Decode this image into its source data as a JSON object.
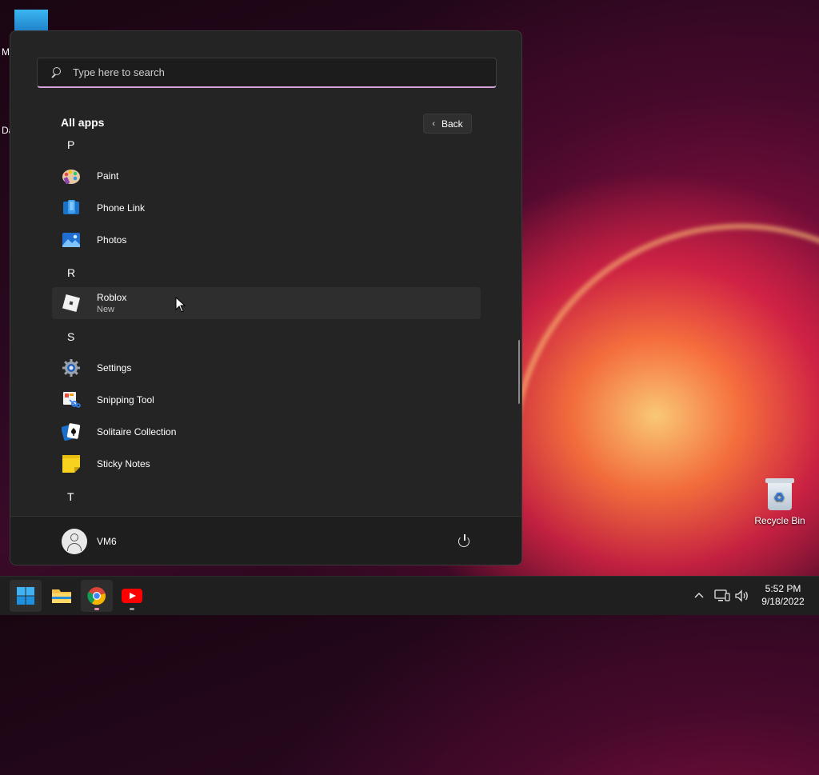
{
  "desktop": {
    "edge_labels": [
      "M",
      "Da"
    ],
    "recycle_bin_label": "Recycle Bin"
  },
  "start_menu": {
    "search_placeholder": "Type here to search",
    "section_title": "All apps",
    "back_label": "Back",
    "groups": [
      {
        "letter": "P",
        "apps": [
          {
            "name": "Paint",
            "icon": "paint-icon"
          },
          {
            "name": "Phone Link",
            "icon": "phone-link-icon"
          },
          {
            "name": "Photos",
            "icon": "photos-icon"
          }
        ]
      },
      {
        "letter": "R",
        "apps": [
          {
            "name": "Roblox",
            "sub": "New",
            "icon": "roblox-icon",
            "hovered": true
          }
        ]
      },
      {
        "letter": "S",
        "apps": [
          {
            "name": "Settings",
            "icon": "settings-gear-icon"
          },
          {
            "name": "Snipping Tool",
            "icon": "snipping-tool-icon"
          },
          {
            "name": "Solitaire Collection",
            "icon": "solitaire-icon"
          },
          {
            "name": "Sticky Notes",
            "icon": "sticky-notes-icon"
          }
        ]
      },
      {
        "letter": "T",
        "apps": []
      }
    ],
    "user": {
      "name": "VM6"
    }
  },
  "taskbar": {
    "pinned": [
      "start-windows-icon",
      "file-explorer-icon",
      "chrome-icon",
      "youtube-icon"
    ],
    "tray_icons": [
      "chevron-up-icon",
      "network-icon",
      "volume-icon"
    ],
    "time": "5:52 PM",
    "date": "9/18/2022"
  },
  "colors": {
    "menu_bg": "#242424",
    "search_accent": "#d4a2d8",
    "taskbar_bg": "#1f1f1f"
  }
}
